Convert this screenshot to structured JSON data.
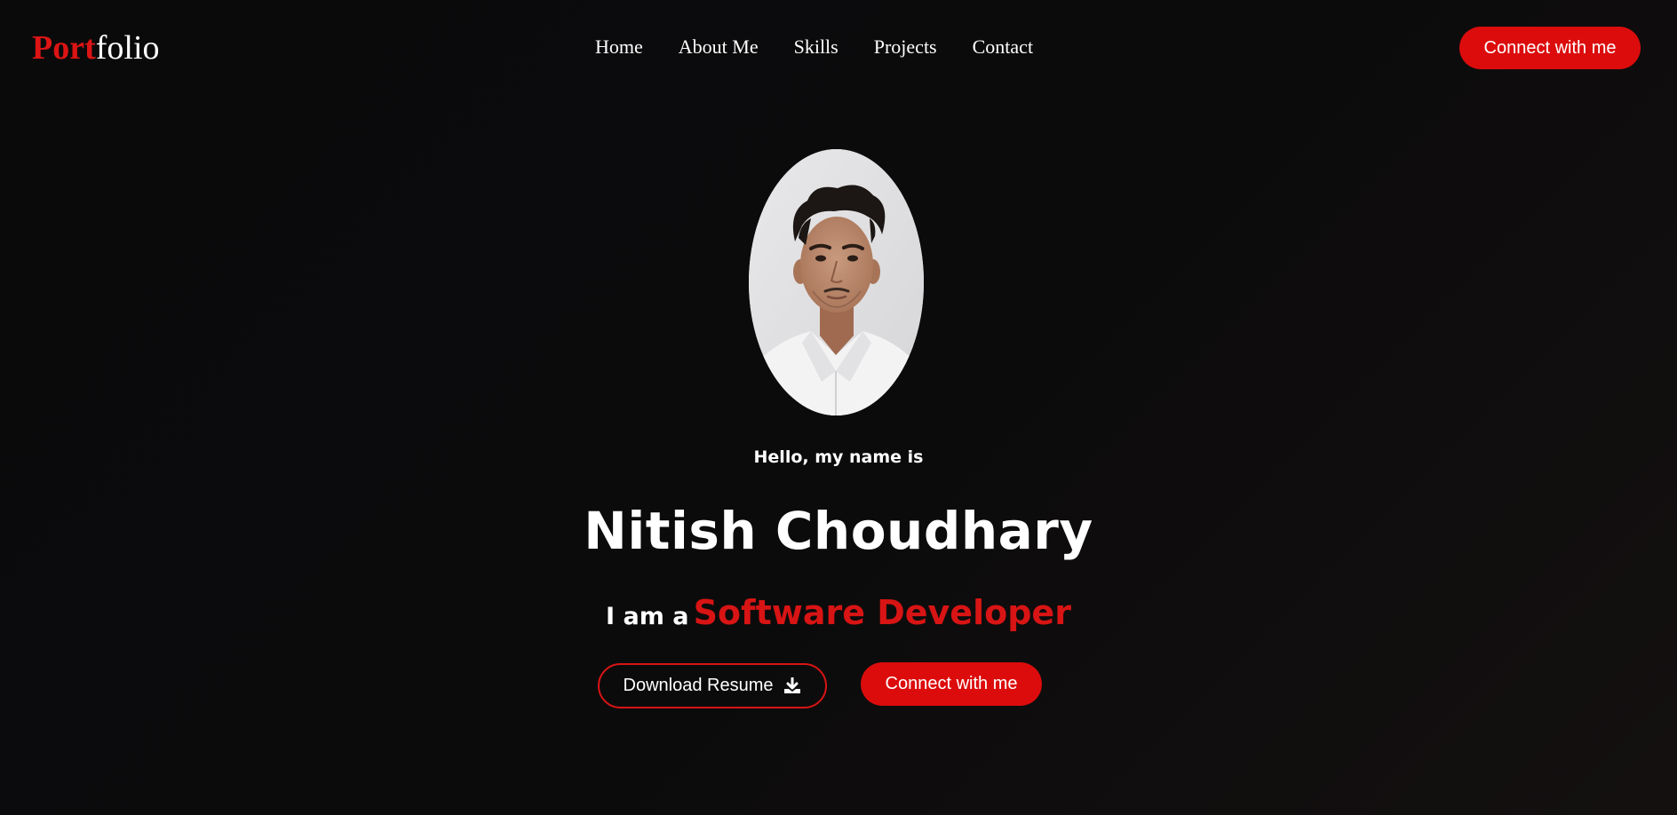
{
  "logo": {
    "accent": "Port",
    "rest": "folio"
  },
  "nav": {
    "links": [
      {
        "label": "Home"
      },
      {
        "label": "About Me"
      },
      {
        "label": "Skills"
      },
      {
        "label": "Projects"
      },
      {
        "label": "Contact"
      }
    ],
    "cta_label": "Connect with me"
  },
  "hero": {
    "greeting": "Hello, my name is",
    "name": "Nitish Choudhary",
    "role_prefix": "I am a",
    "role_title": "Software Developer",
    "download_label": "Download Resume",
    "download_icon": "download-icon",
    "cta_label": "Connect with me"
  },
  "colors": {
    "accent": "#dc0c0c",
    "background": "#0b0a0b",
    "text": "#ffffff"
  }
}
